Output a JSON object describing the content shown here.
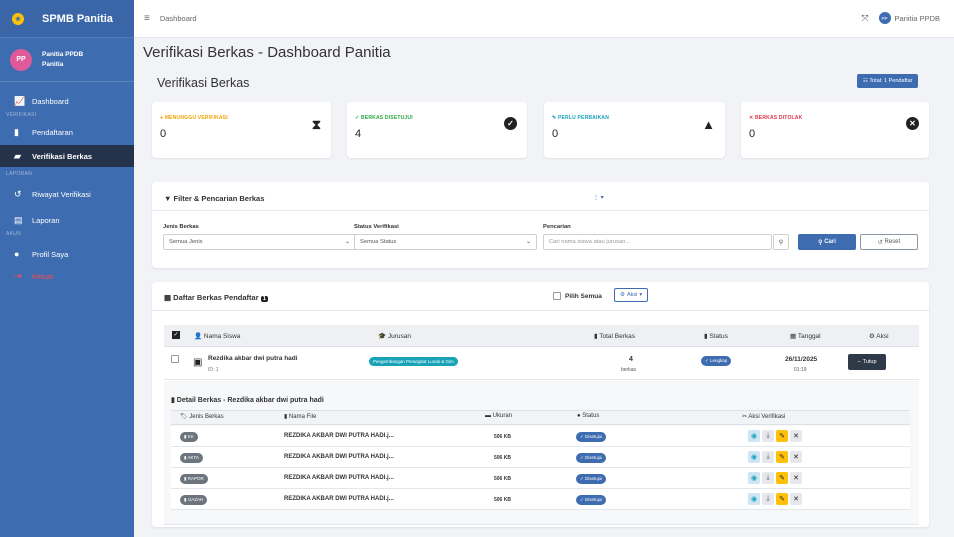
{
  "sidebar": {
    "brand": "SPMB Panitia",
    "user_initials": "PP",
    "user_name": "Panitia PPDB",
    "user_role": "Panitia",
    "sections": {
      "verifikasi": "VERIFIKASI",
      "laporan": "LAPORAN",
      "akun": "AKUN"
    },
    "items": [
      {
        "label": "Dashboard"
      },
      {
        "label": "Pendaftaran"
      },
      {
        "label": "Verifikasi Berkas"
      },
      {
        "label": "Riwayat Verifikasi"
      },
      {
        "label": "Laporan"
      },
      {
        "label": "Profil Saya"
      },
      {
        "label": "Keluar"
      }
    ]
  },
  "topbar": {
    "crumb": "Dashboard",
    "user_initials": "PP",
    "user_name": "Panitia PPDB"
  },
  "page": {
    "title": "Verifikasi Berkas - Dashboard Panitia",
    "subtitle": "Verifikasi Berkas",
    "total_badge": "Total: 1 Pendaftar"
  },
  "stats": [
    {
      "label": "MENUNGGU VERIFIKASI",
      "value": "0",
      "color": "#f0a500"
    },
    {
      "label": "BERKAS DISETUJUI",
      "value": "4",
      "color": "#28a745"
    },
    {
      "label": "PERLU PERBAIKAN",
      "value": "0",
      "color": "#17a2b8"
    },
    {
      "label": "BERKAS DITOLAK",
      "value": "0",
      "color": "#dc3545"
    }
  ],
  "filter": {
    "title": "Filter & Pencarian Berkas",
    "jenis_label": "Jenis Berkas",
    "jenis_value": "Semua Jenis",
    "status_label": "Status Verifikasi",
    "status_value": "Semua Status",
    "search_label": "Pencarian",
    "search_placeholder": "Cari nama siswa atau jurusan...",
    "cari": "Cari",
    "reset": "Reset"
  },
  "list": {
    "title": "Daftar Berkas Pendaftar",
    "count": "1",
    "pilih_semua": "Pilih Semua",
    "aksi": "Aksi",
    "headers": [
      "Nama Siswa",
      "Jurusan",
      "Total Berkas",
      "Status",
      "Tanggal",
      "Aksi"
    ],
    "row": {
      "name": "Rezdika akbar dwi putra hadi",
      "id": "ID: 1",
      "jurusan": "Pengembangan Perangkat Lunak & Gim",
      "total": "4",
      "total_unit": "berkas",
      "status": "Lengkap",
      "date": "26/11/2025",
      "time": "01:19",
      "action": "Tutup"
    }
  },
  "detail": {
    "title": "Detail Berkas - Rezdika akbar dwi putra hadi",
    "headers": [
      "Jenis Berkas",
      "Nama File",
      "Ukuran",
      "Status",
      "Aksi Verifikasi"
    ],
    "rows": [
      {
        "jenis": "KK",
        "file": "REZDIKA AKBAR DWI PUTRA HADI.j...",
        "size": "506 KB",
        "status": "Disetujui"
      },
      {
        "jenis": "AKTA",
        "file": "REZDIKA AKBAR DWI PUTRA HADI.j...",
        "size": "506 KB",
        "status": "Disetujui"
      },
      {
        "jenis": "RAPOR",
        "file": "REZDIKA AKBAR DWI PUTRA HADI.j...",
        "size": "506 KB",
        "status": "Disetujui"
      },
      {
        "jenis": "IJAZAH",
        "file": "REZDIKA AKBAR DWI PUTRA HADI.j...",
        "size": "506 KB",
        "status": "Disetujui"
      }
    ]
  }
}
